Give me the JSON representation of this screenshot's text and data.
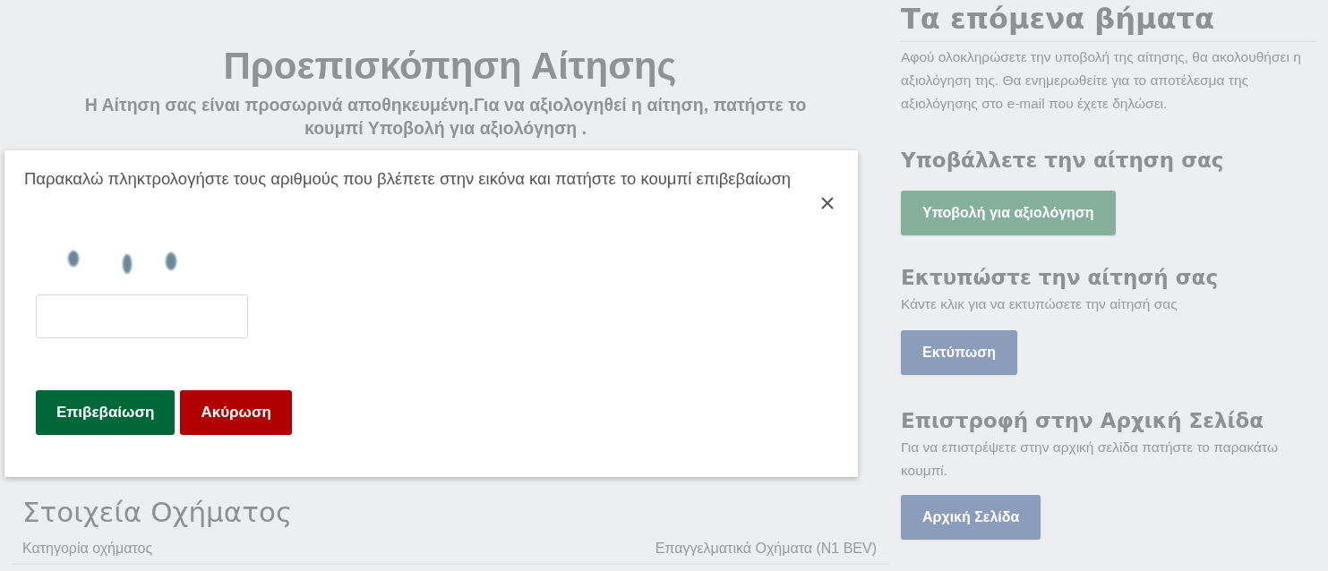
{
  "preview": {
    "title": "Προεπισκόπηση Αίτησης",
    "notice": "Η Αίτηση σας είναι προσωρινά αποθηκευμένη.Για να αξιολογηθεί η αίτηση, πατήστε το κουμπί Υποβολή για αξιολόγηση ."
  },
  "vehicle_details": {
    "title": "Στοιχεία Οχήματος",
    "rows": [
      {
        "label": "Κατηγορία οχήματος",
        "value": "Επαγγελματικά Οχήματα (N1 BEV)"
      }
    ]
  },
  "next_steps": {
    "title": "Τα επόμενα βήματα",
    "text": "Αφού ολοκληρώσετε την υποβολή της αίτησης, θα ακολουθήσει η αξιολόγηση της. Θα ενημερωθείτε για το αποτέλεσμα της αξιολόγησης στο e-mail που έχετε δηλώσει.",
    "sections": [
      {
        "title": "Υποβάλλετε την αίτηση σας",
        "button": {
          "label": "Υποβολή για αξιολόγηση",
          "kind": "submit"
        }
      },
      {
        "title": "Εκτυπώστε την αίτησή σας",
        "text": "Κάντε κλικ για να εκτυπώσετε την αίτησή σας",
        "button": {
          "label": "Εκτύπωση",
          "kind": "secondary"
        }
      },
      {
        "title": "Επιστροφή στην Αρχική Σελίδα",
        "text": "Για να επιστρέψετε στην αρχική σελίδα πατήστε το παρακάτω κουμπί.",
        "button": {
          "label": "Αρχική Σελίδα",
          "kind": "secondary"
        }
      }
    ]
  },
  "captcha_dialog": {
    "message": "Παρακαλώ πληκτρολογήστε τους αριθμούς που βλέπετε στην εικόνα και πατήστε το κουμπί επιβεβαίωση",
    "buttons": [
      {
        "label": "Επιβεβαίωση",
        "kind": "confirm"
      },
      {
        "label": "Ακύρωση",
        "kind": "cancel"
      }
    ]
  }
}
